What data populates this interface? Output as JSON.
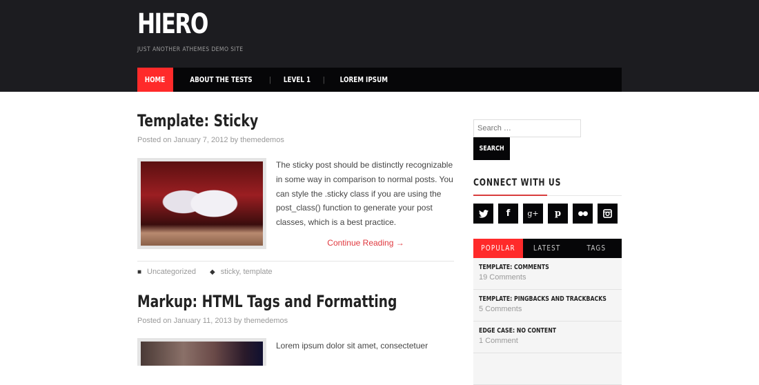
{
  "site": {
    "title": "HIERO",
    "description": "JUST ANOTHER ATHEMES DEMO SITE"
  },
  "nav": {
    "items": [
      {
        "label": "HOME",
        "active": true
      },
      {
        "label": "ABOUT THE TESTS"
      },
      {
        "label": "LEVEL 1"
      },
      {
        "label": "LOREM IPSUM"
      }
    ],
    "separator": "|"
  },
  "posts": [
    {
      "title": "Template: Sticky",
      "meta_prefix": "Posted on",
      "date": "January 7, 2012",
      "by": "by",
      "author": "themedemos",
      "excerpt": "The sticky post should be distinctly recognizable in some way in comparison to normal posts. You can style the .sticky class if you are using the post_class() function to generate your post classes, which is a best practice.",
      "continue_label": "Continue Reading →",
      "category": "Uncategorized",
      "tags": "sticky, template"
    },
    {
      "title": "Markup: HTML Tags and Formatting",
      "meta_prefix": "Posted on",
      "date": "January 11, 2013",
      "by": "by",
      "author": "themedemos",
      "excerpt": "Lorem ipsum dolor sit amet, consectetuer"
    }
  ],
  "sidebar": {
    "search": {
      "placeholder": "Search …",
      "button_label": "SEARCH"
    },
    "connect": {
      "title": "CONNECT WITH US",
      "icons": [
        {
          "name": "twitter-icon",
          "glyph": "🐦"
        },
        {
          "name": "facebook-icon",
          "glyph": "f"
        },
        {
          "name": "google-plus-icon",
          "glyph": "g+"
        },
        {
          "name": "pinterest-icon",
          "glyph": "P"
        },
        {
          "name": "flickr-icon",
          "glyph": "••"
        },
        {
          "name": "instagram-icon",
          "glyph": "◙"
        }
      ]
    },
    "tabs": [
      {
        "label": "POPULAR",
        "active": true
      },
      {
        "label": "LATEST"
      },
      {
        "label": "TAGS"
      }
    ],
    "popular": [
      {
        "title": "TEMPLATE: COMMENTS",
        "comments": "19 Comments"
      },
      {
        "title": "TEMPLATE: PINGBACKS AND TRACKBACKS",
        "comments": "5 Comments"
      },
      {
        "title": "EDGE CASE: NO CONTENT",
        "comments": "1 Comment"
      }
    ]
  },
  "colors": {
    "accent": "#ff2a2a",
    "header_bg": "#1c1c20",
    "nav_bg": "#060608",
    "link": "#e0383e"
  }
}
